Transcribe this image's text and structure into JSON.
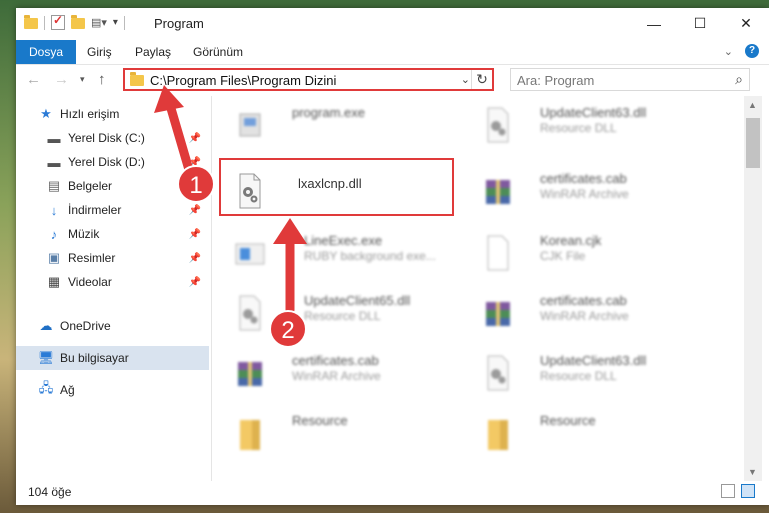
{
  "window": {
    "title": "Program"
  },
  "ribbon": {
    "tabs": [
      "Dosya",
      "Giriş",
      "Paylaş",
      "Görünüm"
    ]
  },
  "address": {
    "path": "C:\\Program Files\\Program Dizini"
  },
  "search": {
    "placeholder": "Ara: Program"
  },
  "sidebar": {
    "items": [
      {
        "label": "Hızlı erişim",
        "icon": "star-icon"
      },
      {
        "label": "Yerel Disk (C:)",
        "icon": "drive-icon",
        "pinned": true
      },
      {
        "label": "Yerel Disk (D:)",
        "icon": "drive-icon",
        "pinned": true
      },
      {
        "label": "Belgeler",
        "icon": "document-icon",
        "pinned": true
      },
      {
        "label": "İndirmeler",
        "icon": "download-icon",
        "pinned": true
      },
      {
        "label": "Müzik",
        "icon": "music-icon",
        "pinned": true
      },
      {
        "label": "Resimler",
        "icon": "picture-icon",
        "pinned": true
      },
      {
        "label": "Videolar",
        "icon": "video-icon",
        "pinned": true
      },
      {
        "label": "OneDrive",
        "icon": "cloud-icon"
      },
      {
        "label": "Bu bilgisayar",
        "icon": "computer-icon",
        "selected": true
      },
      {
        "label": "Ağ",
        "icon": "network-icon"
      }
    ]
  },
  "files": [
    {
      "name": "program.exe",
      "type": "",
      "icon": "exe-icon"
    },
    {
      "name": "UpdateClient63.dll",
      "type": "Resource DLL",
      "icon": "dll-icon"
    },
    {
      "name": "lxaxlcnp.dll",
      "type": "",
      "icon": "dll-icon"
    },
    {
      "name": "certificates.cab",
      "type": "WinRAR Archive",
      "icon": "winrar-icon"
    },
    {
      "name": "LineExec.exe",
      "type": "RUBY background exe...",
      "icon": "exe-icon"
    },
    {
      "name": "Korean.cjk",
      "type": "CJK File",
      "icon": "file-icon"
    },
    {
      "name": "UpdateClient65.dll",
      "type": "Resource DLL",
      "icon": "dll-icon"
    },
    {
      "name": "certificates.cab",
      "type": "WinRAR Archive",
      "icon": "winrar-icon"
    },
    {
      "name": "certificates.cab",
      "type": "WinRAR Archive",
      "icon": "winrar-icon"
    },
    {
      "name": "UpdateClient63.dll",
      "type": "Resource DLL",
      "icon": "dll-icon"
    },
    {
      "name": "Resource",
      "type": "",
      "icon": "folder-icon"
    },
    {
      "name": "Resource",
      "type": "",
      "icon": "folder-icon"
    }
  ],
  "status": {
    "count": "104 öğe"
  },
  "annotations": {
    "step1": "1",
    "step2": "2"
  },
  "colors": {
    "accent": "#1979ca",
    "highlight": "#e03a3a"
  }
}
